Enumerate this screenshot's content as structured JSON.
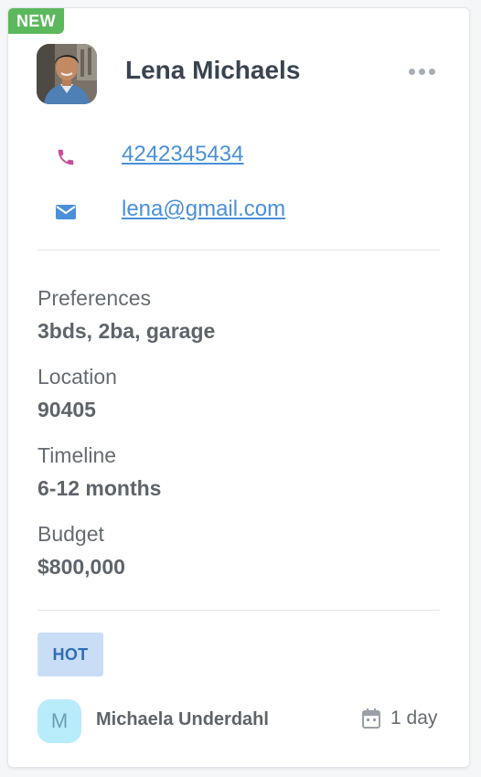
{
  "card": {
    "badge": "NEW",
    "contact": {
      "name": "Lena Michaels",
      "phone": "4242345434",
      "email": "lena@gmail.com"
    },
    "fields": [
      {
        "label": "Preferences",
        "value": "3bds, 2ba, garage"
      },
      {
        "label": "Location",
        "value": "90405"
      },
      {
        "label": "Timeline",
        "value": "6-12 months"
      },
      {
        "label": "Budget",
        "value": "$800,000"
      }
    ],
    "tag": "HOT",
    "assignee": {
      "initial": "M",
      "name": "Michaela Underdahl"
    },
    "due": "1 day"
  },
  "colors": {
    "new_badge": "#5cb85c",
    "link": "#4a90d9",
    "phone_icon": "#c94a9e",
    "email_icon": "#4a90d9",
    "hot_tag_bg": "#c9ddf6",
    "hot_tag_text": "#2f6db8",
    "assignee_avatar_bg": "#b8ecfb"
  },
  "icons": {
    "phone": "phone-icon",
    "email": "email-icon",
    "more": "more-options-icon",
    "calendar": "calendar-icon"
  }
}
